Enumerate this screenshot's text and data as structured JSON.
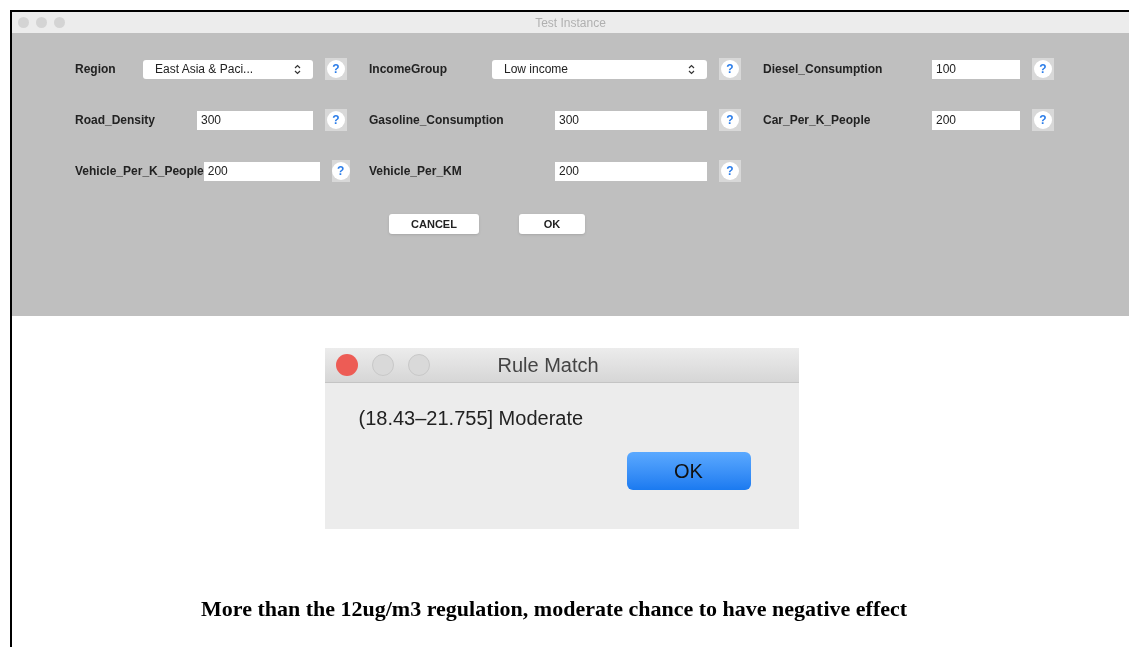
{
  "window": {
    "title": "Test Instance"
  },
  "fields": [
    {
      "label": "Region",
      "kind": "select",
      "value": "East Asia & Paci...",
      "help": "?"
    },
    {
      "label": "IncomeGroup",
      "kind": "select",
      "value": "Low income",
      "help": "?"
    },
    {
      "label": "Diesel_Consumption",
      "kind": "text",
      "value": "100",
      "help": "?"
    },
    {
      "label": "Road_Density",
      "kind": "text",
      "value": "300",
      "help": "?"
    },
    {
      "label": "Gasoline_Consumption",
      "kind": "text",
      "value": "300",
      "help": "?"
    },
    {
      "label": "Car_Per_K_People",
      "kind": "text",
      "value": "200",
      "help": "?"
    },
    {
      "label": "Vehicle_Per_K_People",
      "kind": "text",
      "value": "200",
      "help": "?"
    },
    {
      "label": "Vehicle_Per_KM",
      "kind": "text",
      "value": "200",
      "help": "?"
    }
  ],
  "buttons": [
    "CANCEL",
    "OK"
  ],
  "dialog": {
    "title": "Rule Match",
    "message": "(18.43–21.755] Moderate",
    "button": "OK"
  },
  "caption": "More than the 12ug/m3 regulation, moderate chance to have negative effect"
}
